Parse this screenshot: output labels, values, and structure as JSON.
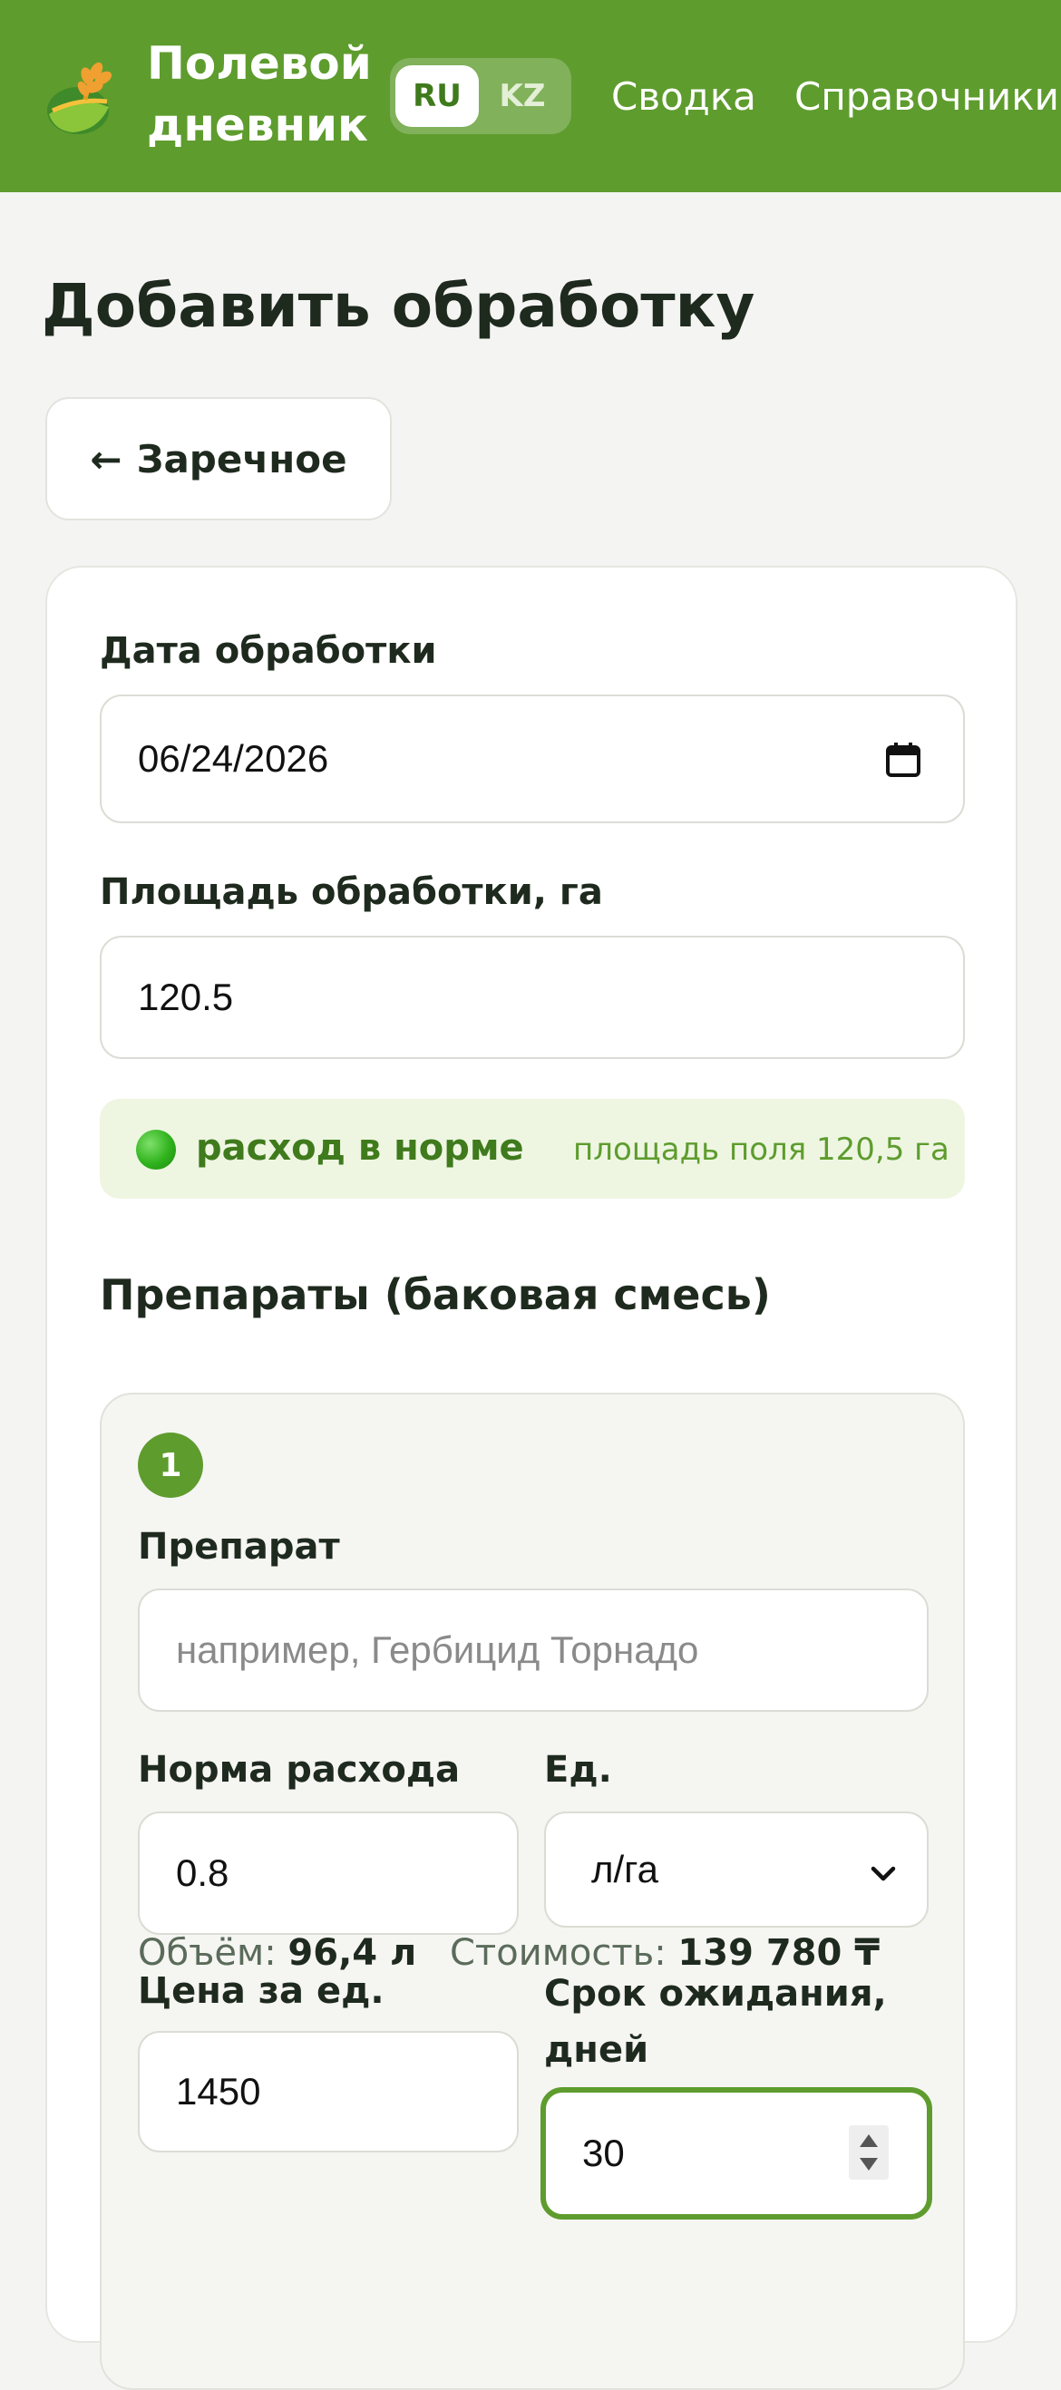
{
  "header": {
    "brand_line1": "Полевой",
    "brand_line2": "дневник",
    "lang_ru": "RU",
    "lang_kz": "KZ",
    "nav_summary": "Сводка",
    "nav_refs": "Справочники",
    "accent": "#5e9c2e"
  },
  "page": {
    "title": "Добавить обработку",
    "back_label": "Заречное",
    "back_icon": "arrow-left-icon"
  },
  "form": {
    "date_label": "Дата обработки",
    "date_value": "06/24/2026",
    "area_label": "Площадь обработки, га",
    "area_value": "120.5",
    "status_main": "расход в норме",
    "status_sub": "площадь поля 120,5 га",
    "section_title": "Препараты (баковая смесь)"
  },
  "product": {
    "index": "1",
    "name_label": "Препарат",
    "name_placeholder": "например, Гербицид Торнадо",
    "rate_label": "Норма расхода",
    "rate_value": "0.8",
    "unit_label": "Ед.",
    "unit_value": "л/га",
    "price_label": "Цена за ед.",
    "price_value": "1450",
    "wait_label_1": "Срок ожидания,",
    "wait_label_2": "дней",
    "wait_value": "30",
    "volume_label": "Объём:",
    "volume_value": "96,4 л",
    "cost_label": "Стоимость:",
    "cost_value": "139 780 ₸"
  }
}
